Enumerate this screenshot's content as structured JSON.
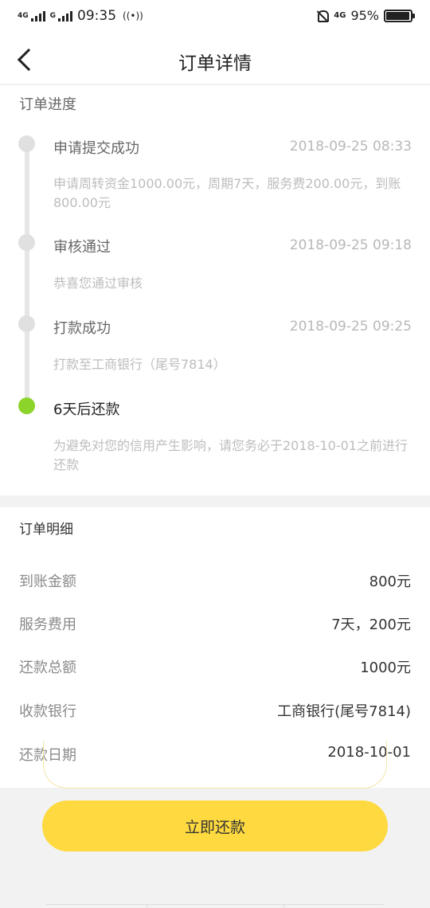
{
  "status_bar": {
    "net_left": "4G",
    "net_left2": "G",
    "time": "09:35",
    "hotspot": "((•))",
    "net_right": "4G",
    "battery": "95%",
    "battery_level": 0.95
  },
  "nav": {
    "title": "订单详情"
  },
  "progress": {
    "title": "订单进度",
    "steps": [
      {
        "title": "申请提交成功",
        "time": "2018-09-25 08:33",
        "desc": "申请周转资金1000.00元，周期7天，服务费200.00元，到账800.00元"
      },
      {
        "title": "审核通过",
        "time": "2018-09-25 09:18",
        "desc": "恭喜您通过审核"
      },
      {
        "title": "打款成功",
        "time": "2018-09-25 09:25",
        "desc": "打款至工商银行（尾号7814）"
      },
      {
        "title": "6天后还款",
        "time": "",
        "desc": "为避免对您的信用产生影响，请您务必于2018-10-01之前进行还款"
      }
    ]
  },
  "details": {
    "title": "订单明细",
    "rows": [
      {
        "label": "到账金额",
        "value": "800元"
      },
      {
        "label": "服务费用",
        "value": "7天，200元"
      },
      {
        "label": "还款总额",
        "value": "1000元"
      },
      {
        "label": "收款银行",
        "value": "工商银行(尾号7814)"
      },
      {
        "label": "还款日期",
        "value": "2018-10-01"
      }
    ]
  },
  "pay_button": "立即还款",
  "colors": {
    "accent": "#fed93f",
    "active_dot": "#8cd32a"
  }
}
